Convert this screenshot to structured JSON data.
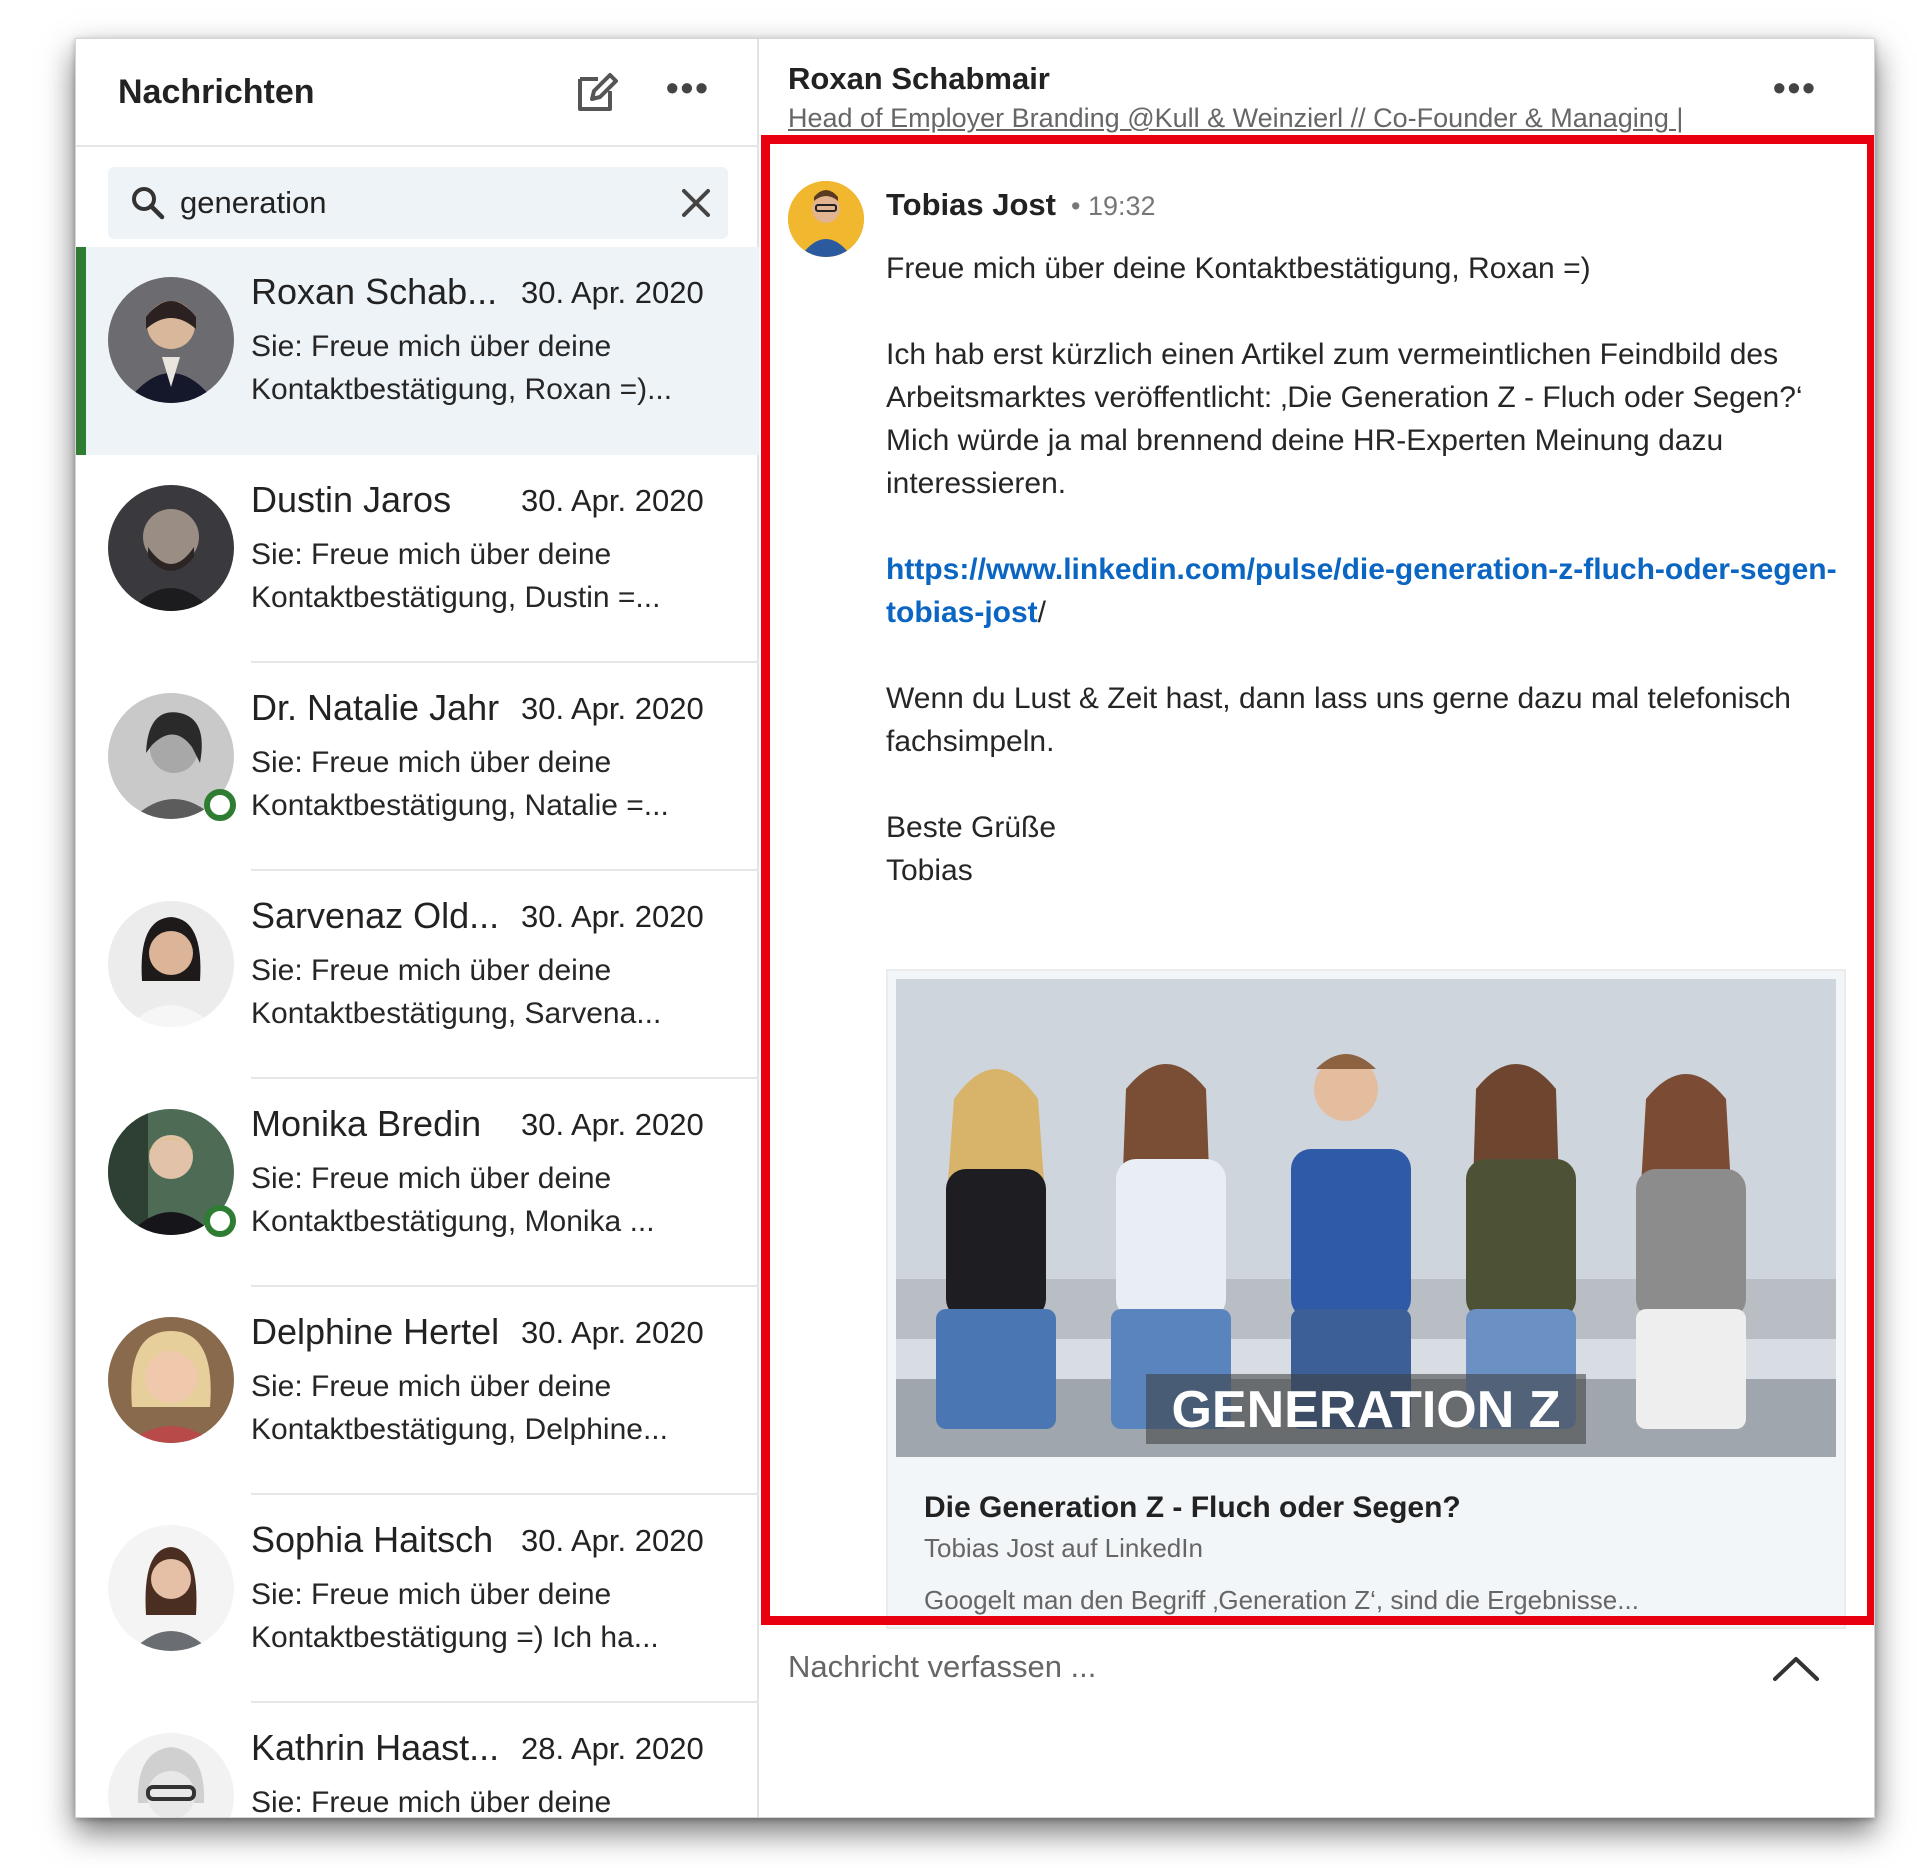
{
  "left_header": {
    "title": "Nachrichten",
    "compose_icon": "compose-icon",
    "more_icon": "more-dots-icon",
    "more_text": "•••"
  },
  "search": {
    "value": "generation",
    "icon": "search-icon",
    "clear_icon": "close-icon"
  },
  "conversations": [
    {
      "name": "Roxan Schab...",
      "date": "30. Apr. 2020",
      "preview1": "Sie: Freue mich über deine",
      "preview2": "Kontaktbestätigung, Roxan =)...",
      "active": true,
      "online": false
    },
    {
      "name": "Dustin Jaros",
      "date": "30. Apr. 2020",
      "preview1": "Sie: Freue mich über deine",
      "preview2": "Kontaktbestätigung, Dustin =...",
      "active": false,
      "online": false
    },
    {
      "name": "Dr. Natalie Jahr",
      "date": "30. Apr. 2020",
      "preview1": "Sie: Freue mich über deine",
      "preview2": "Kontaktbestätigung, Natalie =...",
      "active": false,
      "online": true
    },
    {
      "name": "Sarvenaz Old...",
      "date": "30. Apr. 2020",
      "preview1": "Sie: Freue mich über deine",
      "preview2": "Kontaktbestätigung, Sarvena...",
      "active": false,
      "online": false
    },
    {
      "name": "Monika Bredin",
      "date": "30. Apr. 2020",
      "preview1": "Sie: Freue mich über deine",
      "preview2": "Kontaktbestätigung, Monika ...",
      "active": false,
      "online": true
    },
    {
      "name": "Delphine Hertel",
      "date": "30. Apr. 2020",
      "preview1": "Sie: Freue mich über deine",
      "preview2": "Kontaktbestätigung, Delphine...",
      "active": false,
      "online": false
    },
    {
      "name": "Sophia Haitsch",
      "date": "30. Apr. 2020",
      "preview1": "Sie: Freue mich über deine",
      "preview2": "Kontaktbestätigung =) Ich ha...",
      "active": false,
      "online": false
    },
    {
      "name": "Kathrin Haast...",
      "date": "28. Apr. 2020",
      "preview1": "Sie: Freue mich über deine",
      "preview2": "",
      "active": false,
      "online": false
    }
  ],
  "thread": {
    "name": "Roxan Schabmair",
    "subtitle": "Head of Employer Branding @Kull & Weinzierl // Co-Founder & Managing |",
    "more_text": "•••"
  },
  "message": {
    "sender": "Tobias Jost",
    "time": "• 19:32",
    "line1": "Freue mich über deine Kontaktbestätigung, Roxan =)",
    "para2a": "Ich hab erst kürzlich einen Artikel zum vermeintlichen Feindbild des Arbeitsmarktes veröffentlicht: ‚Die Generation Z - Fluch oder Segen?‘",
    "para2b": "Mich würde ja mal brennend deine HR-Experten Meinung dazu interessieren.",
    "link": "https://www.linkedin.com/pulse/die-generation-z-fluch-oder-segen-tobias-jost",
    "link_tail": "/",
    "para4": "Wenn du Lust & Zeit hast, dann lass uns gerne dazu mal telefonisch fachsimpeln.",
    "closing": "Beste Grüße",
    "signature": "Tobias"
  },
  "card": {
    "image_caption": "GENERATION Z",
    "title": "Die Generation Z - Fluch oder Segen?",
    "source": "Tobias Jost auf LinkedIn",
    "description": "Googelt man den Begriff ‚Generation Z‘, sind die Ergebnisse..."
  },
  "composer": {
    "placeholder": "Nachricht verfassen ...",
    "expand_icon": "chevron-up-icon"
  },
  "colors": {
    "accent_link": "#0a66c2",
    "active_bar": "#2e7d32",
    "highlight": "#e8000f",
    "search_bg": "#eef3f8"
  }
}
